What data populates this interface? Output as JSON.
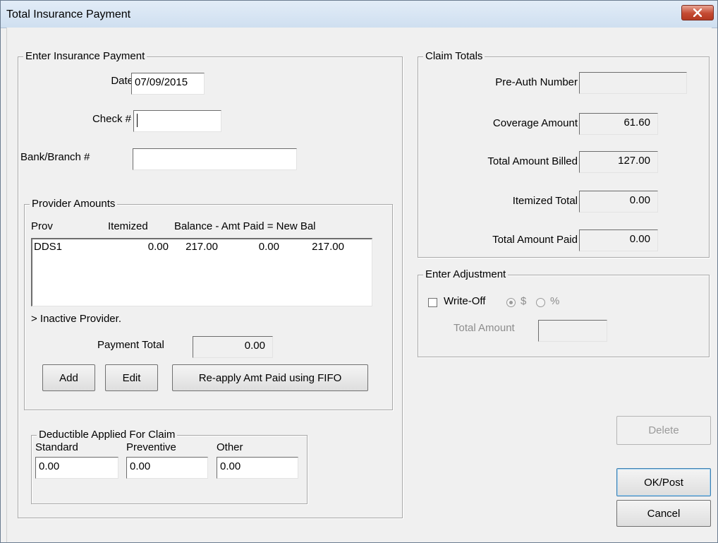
{
  "window": {
    "title": "Total Insurance Payment"
  },
  "enter_payment": {
    "legend": "Enter Insurance Payment",
    "date_label": "Date",
    "date_value": "07/09/2015",
    "check_label": "Check #",
    "check_value": "",
    "bank_label": "Bank/Branch #",
    "bank_value": ""
  },
  "provider_amounts": {
    "legend": "Provider Amounts",
    "headers": {
      "prov": "Prov",
      "itemized": "Itemized",
      "balance_chain": "Balance - Amt Paid = New Bal"
    },
    "rows": [
      {
        "prov": "DDS1",
        "itemized": "0.00",
        "balance": "217.00",
        "amt_paid": "0.00",
        "new_bal": "217.00"
      }
    ],
    "inactive_note": "> Inactive Provider.",
    "payment_total_label": "Payment Total",
    "payment_total_value": "0.00",
    "buttons": {
      "add": "Add",
      "edit": "Edit",
      "reapply": "Re-apply Amt Paid using FIFO"
    }
  },
  "deductible": {
    "legend": "Deductible Applied For Claim",
    "standard_label": "Standard",
    "standard_value": "0.00",
    "preventive_label": "Preventive",
    "preventive_value": "0.00",
    "other_label": "Other",
    "other_value": "0.00"
  },
  "claim_totals": {
    "legend": "Claim Totals",
    "preauth_label": "Pre-Auth Number",
    "preauth_value": "",
    "coverage_label": "Coverage Amount",
    "coverage_value": "61.60",
    "billed_label": "Total Amount Billed",
    "billed_value": "127.00",
    "itemized_label": "Itemized Total",
    "itemized_value": "0.00",
    "paid_label": "Total Amount Paid",
    "paid_value": "0.00"
  },
  "adjustment": {
    "legend": "Enter Adjustment",
    "writeoff_label": "Write-Off",
    "writeoff_checked": false,
    "dollar_label": "$",
    "percent_label": "%",
    "total_amount_label": "Total Amount",
    "total_amount_value": ""
  },
  "actions": {
    "delete": "Delete",
    "ok_post": "OK/Post",
    "cancel": "Cancel"
  },
  "colors": {
    "close_button": "#c44a32",
    "titlebar": "#dce7f3",
    "dialog_bg": "#f0f0f0"
  },
  "icons": {
    "close": "close-icon"
  }
}
